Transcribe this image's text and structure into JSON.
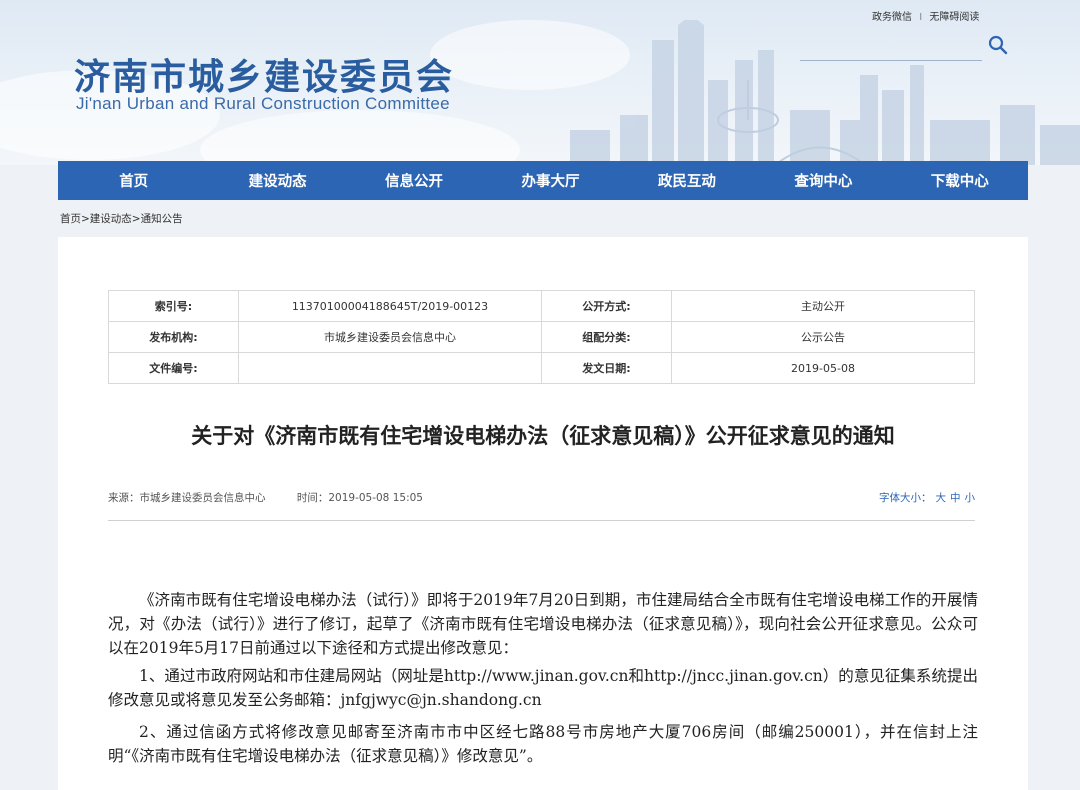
{
  "header": {
    "logo_cn": "济南市城乡建设委员会",
    "logo_en": "Ji'nan Urban and Rural Construction Committee",
    "top_links": [
      "政务微信",
      "无障碍阅读"
    ],
    "top_links_sep": "I"
  },
  "nav": {
    "items": [
      "首页",
      "建设动态",
      "信息公开",
      "办事大厅",
      "政民互动",
      "查询中心",
      "下载中心"
    ]
  },
  "breadcrumb": "首页>建设动态>通知公告",
  "meta": {
    "index_label": "索引号:",
    "index_value": "11370100004188645T/2019-00123",
    "publish_mode_label": "公开方式:",
    "publish_mode_value": "主动公开",
    "agency_label": "发布机构:",
    "agency_value": "市城乡建设委员会信息中心",
    "category_label": "组配分类:",
    "category_value": "公示公告",
    "doc_no_label": "文件编号:",
    "doc_no_value": "",
    "date_label": "发文日期:",
    "date_value": "2019-05-08"
  },
  "article": {
    "title": "关于对《济南市既有住宅增设电梯办法（征求意见稿）》公开征求意见的通知",
    "source": "来源：市城乡建设委员会信息中心",
    "time": "时间：2019-05-08 15:05",
    "font_size_label": "字体大小：",
    "font_sizes": [
      "大",
      "中",
      "小"
    ],
    "paragraphs": [
      "《济南市既有住宅增设电梯办法（试行）》即将于2019年7月20日到期，市住建局结合全市既有住宅增设电梯工作的开展情况，对《办法（试行）》进行了修订，起草了《济南市既有住宅增设电梯办法（征求意见稿）》，现向社会公开征求意见。公众可以在2019年5月17日前通过以下途径和方式提出修改意见：",
      "1、通过市政府网站和市住建局网站（网址是http://www.jinan.gov.cn和http://jncc.jinan.gov.cn）的意见征集系统提出修改意见或将意见发至公务邮箱：jnfgjwyc@jn.shandong.cn",
      "2、通过信函方式将修改意见邮寄至济南市市中区经七路88号市房地产大厦706房间（邮编250001），并在信封上注明“《济南市既有住宅增设电梯办法（征求意见稿）》修改意见”。"
    ]
  },
  "colors": {
    "nav_bg": "#2c65b4",
    "logo": "#2a5d9f",
    "accent": "#2c65b4"
  }
}
